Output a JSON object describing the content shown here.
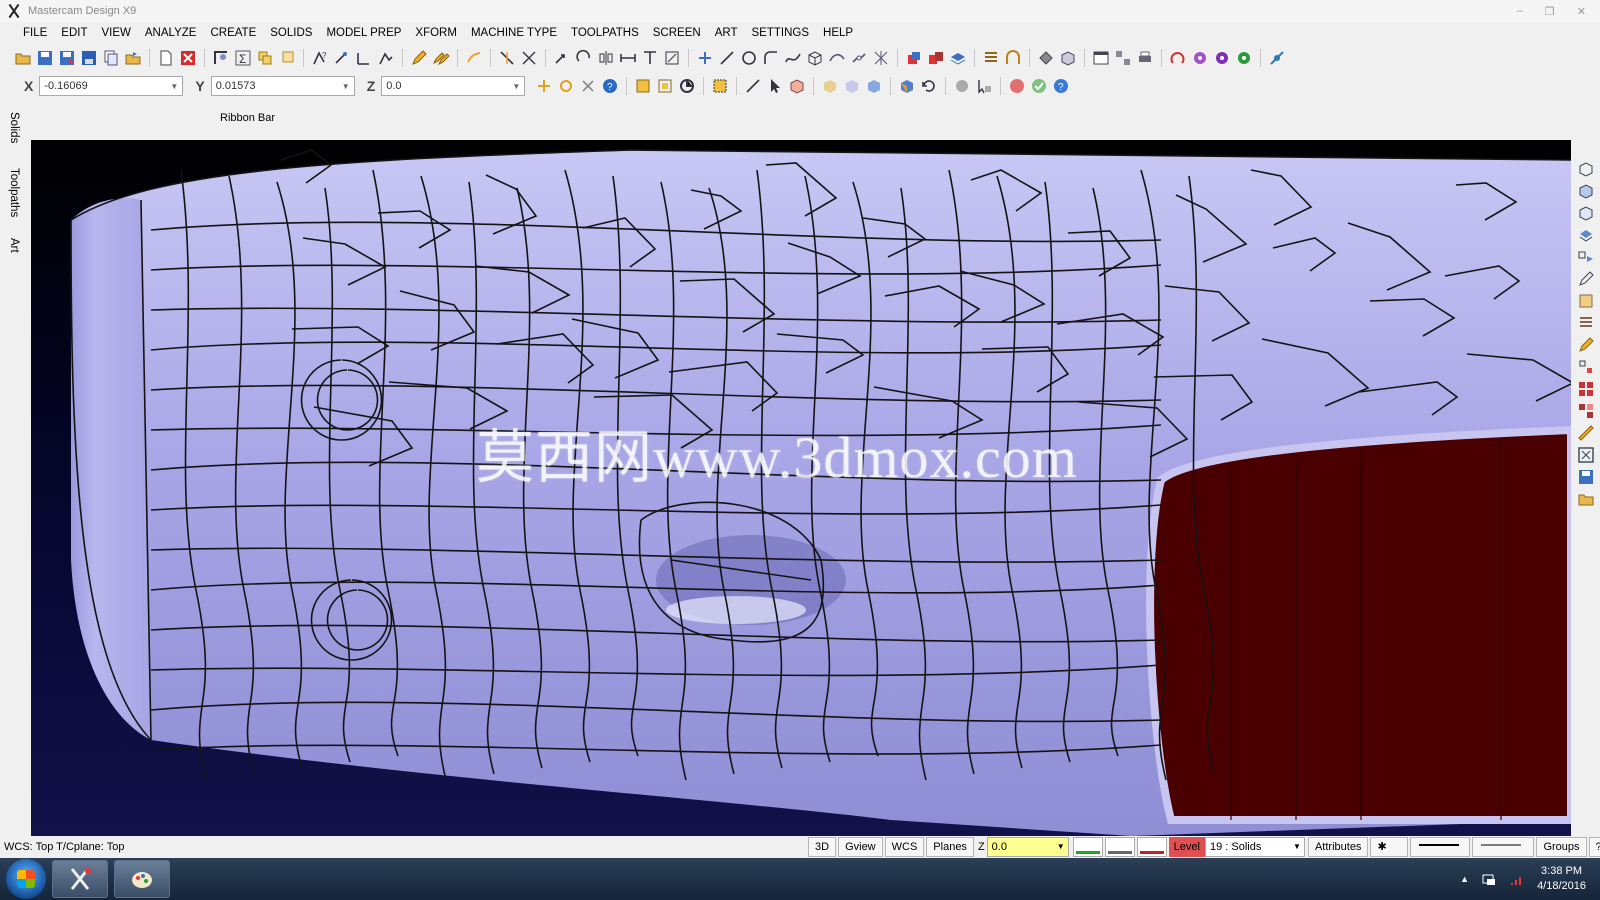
{
  "window": {
    "title": "Mastercam Design X9",
    "minimize": "–",
    "restore": "❐",
    "close": "✕"
  },
  "menu": [
    "FILE",
    "EDIT",
    "VIEW",
    "ANALYZE",
    "CREATE",
    "SOLIDS",
    "MODEL PREP",
    "XFORM",
    "MACHINE TYPE",
    "TOOLPATHS",
    "SCREEN",
    "ART",
    "SETTINGS",
    "HELP"
  ],
  "coords": {
    "x_label": "X",
    "x_value": "-0.16069",
    "y_label": "Y",
    "y_value": "0.01573",
    "z_label": "Z",
    "z_value": "0.0"
  },
  "ribbon": {
    "label": "Ribbon Bar"
  },
  "left_tabs": [
    "Solids",
    "Toolpaths",
    "Art"
  ],
  "viewport": {
    "watermark": "莫西网www.3dmox.com",
    "surface_color": "#a8a6e6",
    "face_color": "#4a0000"
  },
  "status": {
    "wcs_text": "WCS: Top  T/Cplane: Top",
    "btn_3d": "3D",
    "btn_gview": "Gview",
    "btn_wcs": "WCS",
    "btn_planes": "Planes",
    "z_label": "Z",
    "z_value": "0.0",
    "level_label": "Level",
    "level_value": "19 : Solids",
    "btn_attributes": "Attributes",
    "point_style": "✱",
    "btn_groups": "Groups",
    "btn_help": "?"
  },
  "taskbar": {
    "time": "3:38 PM",
    "date": "4/18/2016"
  }
}
